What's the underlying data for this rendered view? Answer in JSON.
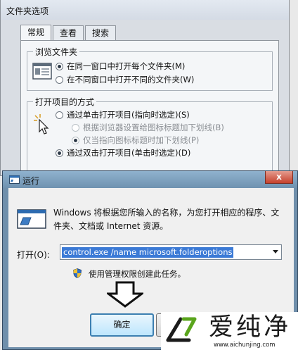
{
  "folder_options": {
    "title": "文件夹选项",
    "tabs": [
      "常规",
      "查看",
      "搜索"
    ],
    "browse_group": {
      "title": "浏览文件夹",
      "options": [
        {
          "label": "在同一窗口中打开每个文件夹(M)",
          "selected": true
        },
        {
          "label": "在不同窗口中打开不同的文件夹(W)",
          "selected": false
        }
      ]
    },
    "click_group": {
      "title": "打开项目的方式",
      "options": [
        {
          "label": "通过单击打开项目(指向时选定)(S)",
          "selected": false
        },
        {
          "label": "根据浏览器设置给图标标题加下划线(B)",
          "selected": false,
          "disabled": true
        },
        {
          "label": "仅当指向图标标题时加下划线(P)",
          "selected": true,
          "disabled": true
        },
        {
          "label": "通过双击打开项目(单击时选定)(D)",
          "selected": true
        }
      ]
    }
  },
  "run_dialog": {
    "title": "运行",
    "close_label": "x",
    "description": "Windows 将根据您所输入的名称，为您打开相应的程序、文件夹、文档或 Internet 资源。",
    "open_label": "打开(O):",
    "open_value": "control.exe /name microsoft.folderoptions",
    "admin_text": "使用管理权限创建此任务。",
    "ok_label": "确定"
  },
  "watermark": {
    "text": "爱纯净",
    "url": "www.aichunjing.com"
  }
}
